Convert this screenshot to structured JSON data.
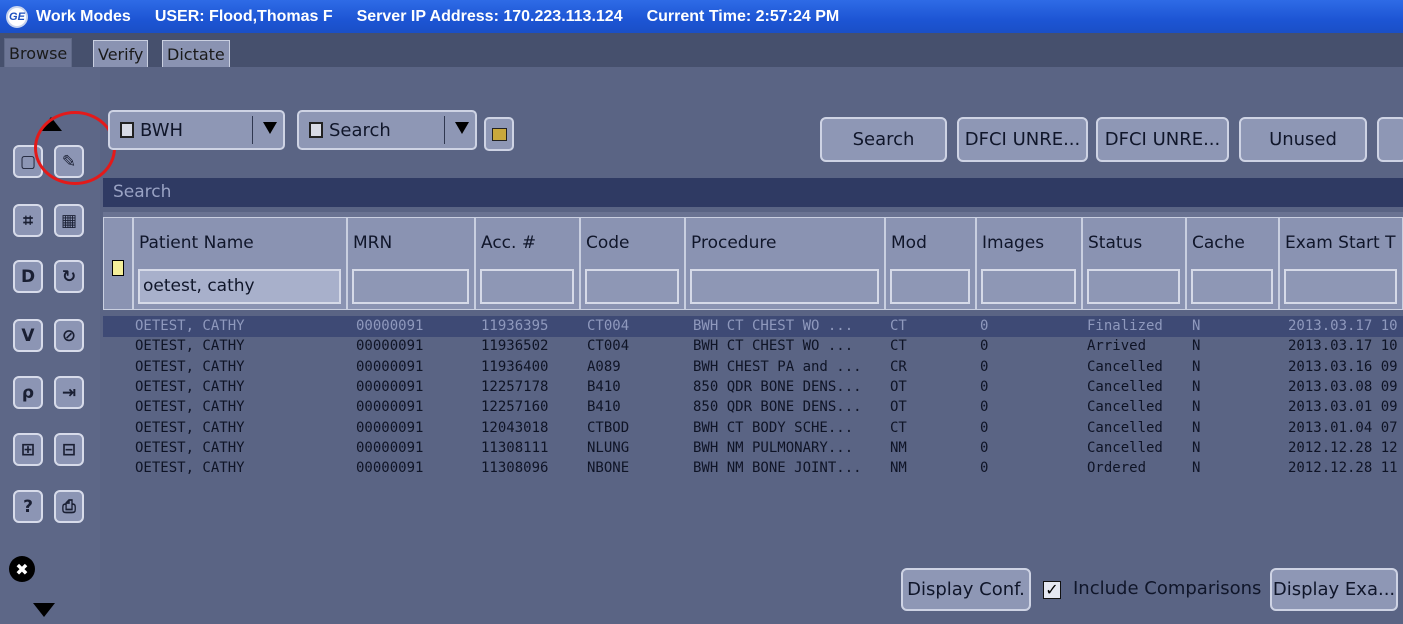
{
  "titlebar": {
    "logo": "GE",
    "app": "Work Modes",
    "user": "USER: Flood,Thomas F",
    "server": "Server IP Address: 170.223.113.124",
    "time": "Current Time: 2:57:24 PM"
  },
  "tabs": [
    "Browse",
    "Verify",
    "Dictate"
  ],
  "sidebar": {
    "buttons": [
      {
        "name": "select-icon",
        "glyph": "▢"
      },
      {
        "name": "edit-icon",
        "glyph": "✎"
      },
      {
        "name": "binoculars-icon",
        "glyph": "⌗"
      },
      {
        "name": "barcode-icon",
        "glyph": "▦"
      },
      {
        "name": "d-icon",
        "glyph": "D"
      },
      {
        "name": "refresh-icon",
        "glyph": "↻"
      },
      {
        "name": "v-icon",
        "glyph": "V"
      },
      {
        "name": "cancel-icon",
        "glyph": "⊘"
      },
      {
        "name": "lasso-icon",
        "glyph": "ρ"
      },
      {
        "name": "export-icon",
        "glyph": "⇥"
      },
      {
        "name": "expand-icon",
        "glyph": "⊞"
      },
      {
        "name": "collapse-icon",
        "glyph": "⊟"
      },
      {
        "name": "help-icon",
        "glyph": "?"
      },
      {
        "name": "print-icon",
        "glyph": "⎙"
      }
    ],
    "close_glyph": "✖"
  },
  "toolbar": {
    "site_value": "BWH",
    "search_value": "Search",
    "buttons": [
      "Search",
      "DFCI UNRE...",
      "DFCI UNRE...",
      "Unused"
    ]
  },
  "search_label": "Search",
  "columns": [
    {
      "label": "Patient Name",
      "filter": "oetest, cathy"
    },
    {
      "label": "MRN",
      "filter": ""
    },
    {
      "label": "Acc. #",
      "filter": ""
    },
    {
      "label": "Code",
      "filter": ""
    },
    {
      "label": "Procedure",
      "filter": ""
    },
    {
      "label": "Mod",
      "filter": ""
    },
    {
      "label": "Images",
      "filter": ""
    },
    {
      "label": "Status",
      "filter": ""
    },
    {
      "label": "Cache",
      "filter": ""
    },
    {
      "label": "Exam Start T",
      "filter": ""
    }
  ],
  "rows": [
    [
      "OETEST, CATHY",
      "00000091",
      "11936395",
      "CT004",
      "BWH CT CHEST WO ...",
      "CT",
      "0",
      "Finalized",
      "N",
      "2013.03.17 10"
    ],
    [
      "OETEST, CATHY",
      "00000091",
      "11936502",
      "CT004",
      "BWH CT CHEST WO ...",
      "CT",
      "0",
      "Arrived",
      "N",
      "2013.03.17 10"
    ],
    [
      "OETEST, CATHY",
      "00000091",
      "11936400",
      "A089",
      "BWH CHEST PA and ...",
      "CR",
      "0",
      "Cancelled",
      "N",
      "2013.03.16 09"
    ],
    [
      "OETEST, CATHY",
      "00000091",
      "12257178",
      "B410",
      "850 QDR BONE DENS...",
      "OT",
      "0",
      "Cancelled",
      "N",
      "2013.03.08 09"
    ],
    [
      "OETEST, CATHY",
      "00000091",
      "12257160",
      "B410",
      "850 QDR BONE DENS...",
      "OT",
      "0",
      "Cancelled",
      "N",
      "2013.03.01 09"
    ],
    [
      "OETEST, CATHY",
      "00000091",
      "12043018",
      "CTBOD",
      "BWH CT BODY SCHE...",
      "CT",
      "0",
      "Cancelled",
      "N",
      "2013.01.04 07"
    ],
    [
      "OETEST, CATHY",
      "00000091",
      "11308111",
      "NLUNG",
      "BWH NM PULMONARY...",
      "NM",
      "0",
      "Cancelled",
      "N",
      "2012.12.28 12"
    ],
    [
      "OETEST, CATHY",
      "00000091",
      "11308096",
      "NBONE",
      "BWH NM BONE JOINT...",
      "NM",
      "0",
      "Ordered",
      "N",
      "2012.12.28 11"
    ]
  ],
  "bottom": {
    "display_conf": "Display Conf.",
    "include_checked": "✓",
    "include_label": "Include Comparisons",
    "display_exam": "Display Exa..."
  }
}
